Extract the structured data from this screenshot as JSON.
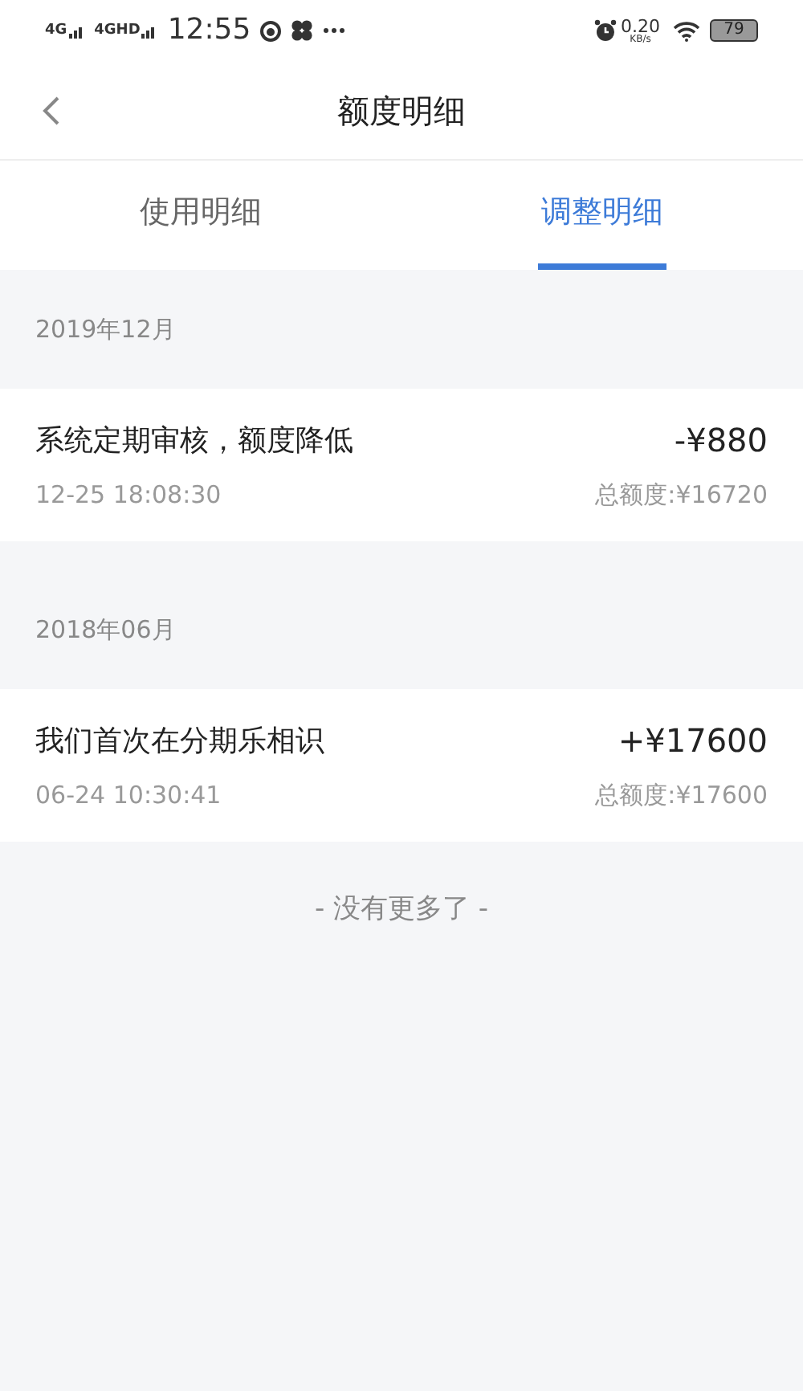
{
  "status_bar": {
    "signal_1": "4G",
    "signal_2": "4GHD",
    "time": "12:55",
    "speed": "0.20",
    "speed_unit": "KB/s",
    "battery": "79"
  },
  "header": {
    "title": "额度明细"
  },
  "tabs": [
    {
      "label": "使用明细",
      "selected": false
    },
    {
      "label": "调整明细",
      "selected": true
    }
  ],
  "groups": [
    {
      "month": "2019年12月",
      "records": [
        {
          "title": "系统定期审核，额度降低",
          "time": "12-25 18:08:30",
          "amount": "-¥880",
          "total": "总额度:¥16720"
        }
      ]
    },
    {
      "month": "2018年06月",
      "records": [
        {
          "title": "我们首次在分期乐相识",
          "time": "06-24 10:30:41",
          "amount": "+¥17600",
          "total": "总额度:¥17600"
        }
      ]
    }
  ],
  "end_note": "- 没有更多了 -"
}
